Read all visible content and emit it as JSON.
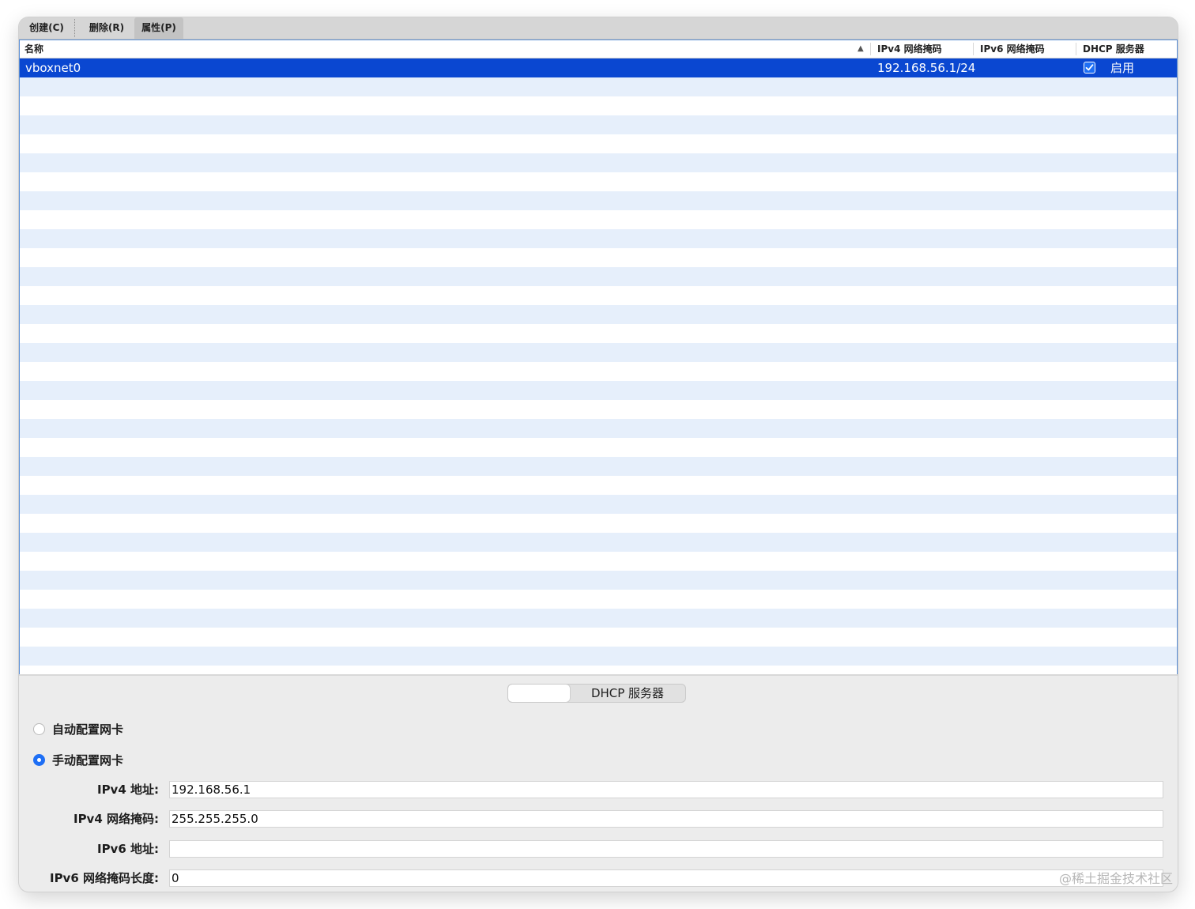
{
  "toolbar": {
    "create_label": "创建(C)",
    "delete_label": "删除(R)",
    "properties_label": "属性(P)"
  },
  "table": {
    "columns": {
      "name": "名称",
      "ipv4_mask": "IPv4 网络掩码",
      "ipv6_mask": "IPv6 网络掩码",
      "dhcp": "DHCP 服务器"
    },
    "sort_indicator": "▲",
    "rows": [
      {
        "name": "vboxnet0",
        "ipv4_mask": "192.168.56.1/24",
        "ipv6_mask": "",
        "dhcp_checked": true,
        "dhcp_label": "启用"
      }
    ]
  },
  "details": {
    "tabs": {
      "adapter": "",
      "dhcp": "DHCP 服务器"
    },
    "radio_auto_label": "自动配置网卡",
    "radio_manual_label": "手动配置网卡",
    "selected_mode": "manual",
    "fields": {
      "ipv4_address": {
        "label": "IPv4 地址:",
        "value": "192.168.56.1"
      },
      "ipv4_mask": {
        "label": "IPv4 网络掩码:",
        "value": "255.255.255.0"
      },
      "ipv6_address": {
        "label": "IPv6 地址:",
        "value": ""
      },
      "ipv6_prefix": {
        "label": "IPv6 网络掩码长度:",
        "value": "0"
      }
    }
  },
  "watermark": "@稀土掘金技术社区",
  "colors": {
    "selection": "#0a47d1",
    "accent": "#1e6ff5",
    "stripe": "#e6effb"
  }
}
